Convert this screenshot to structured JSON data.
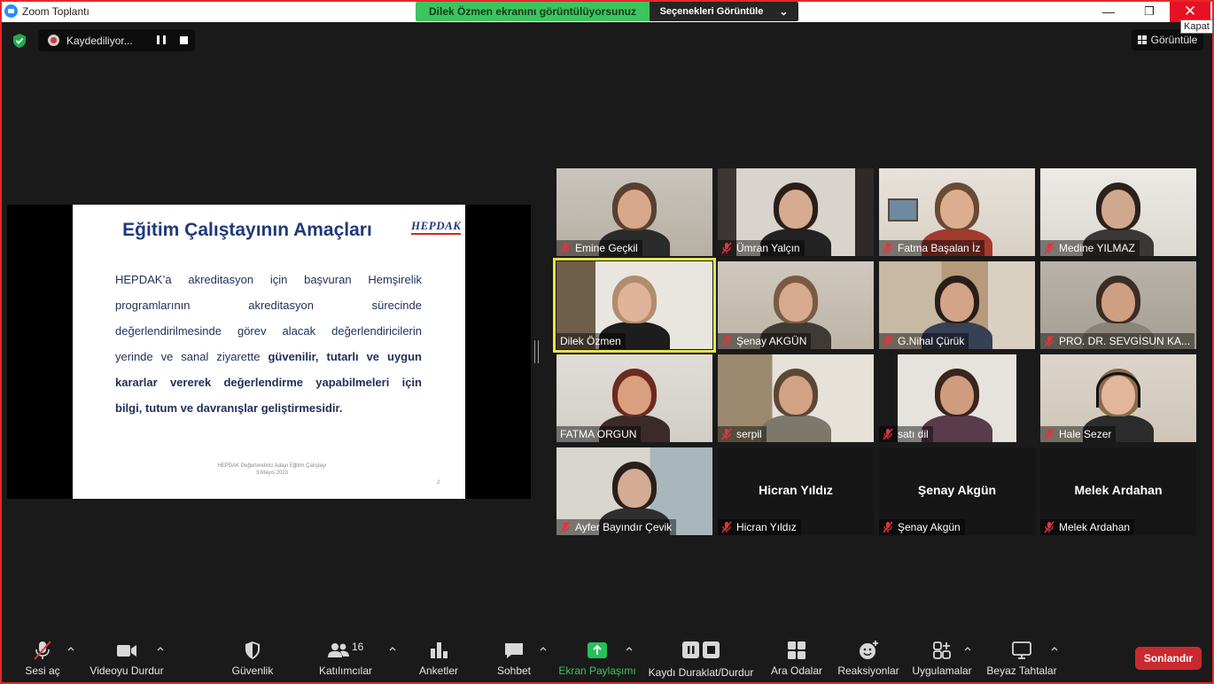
{
  "window": {
    "title": "Zoom Toplantı",
    "close_tooltip": "Kapat",
    "minimize_glyph": "—",
    "maximize_glyph": "❐",
    "close_glyph": "✕"
  },
  "share_banner": {
    "text": "Dilek Özmen ekranını görüntülüyorsunuz",
    "options_label": "Seçenekleri Görüntüle",
    "options_glyph": "⌄"
  },
  "recording": {
    "label": "Kaydediliyor..."
  },
  "view_button": {
    "label": "Görüntüle"
  },
  "slide": {
    "title": "Eğitim Çalıştayının Amaçları",
    "logo": "HEPDAK",
    "lines": [
      "HEPDAK’a  akreditasyon için başvuran Hemşirelik",
      "programlarının akreditasyon sürecinde",
      "değerlendirilmesinde görev alacak değerlendiricilerin"
    ],
    "line4_normal": "yerinde ve sanal ziyarette ",
    "line4_bold": "güvenilir, tutarlı ve uygun",
    "bold_lines": [
      "kararlar vererek değerlendirme yapabilmeleri için",
      "bilgi, tutum ve davranışlar geliştirmesidir."
    ],
    "footer_line1": "HEPDAK Değerlendirici Adayı Eğitim Çalıştayı",
    "footer_line2": "3 Mayıs 2023",
    "page": "2"
  },
  "participants": [
    {
      "name": "Emine Geçkil",
      "muted": true
    },
    {
      "name": "Ümran Yalçın",
      "muted": true
    },
    {
      "name": "Fatma Başalan İz",
      "muted": true
    },
    {
      "name": "Medine YILMAZ",
      "muted": true
    },
    {
      "name": "Dilek Özmen",
      "muted": false,
      "active_speaker": true
    },
    {
      "name": "Şenay AKGÜN",
      "muted": true
    },
    {
      "name": "G.Nihal Çürük",
      "muted": true
    },
    {
      "name": "PRO. DR. SEVGİSUN KA...",
      "muted": true
    },
    {
      "name": "FATMA ORGUN",
      "muted": false
    },
    {
      "name": "serpil",
      "muted": true
    },
    {
      "name": "satı dil",
      "muted": true
    },
    {
      "name": "Hale Sezer",
      "muted": true
    },
    {
      "name": "Ayfer Bayındır Çevik",
      "muted": true
    },
    {
      "name": "Hicran Yıldız",
      "muted": true,
      "video_off": true,
      "display_name": "Hicran Yıldız"
    },
    {
      "name": "Şenay Akgün",
      "muted": true,
      "video_off": true,
      "display_name": "Şenay Akgün"
    },
    {
      "name": "Melek Ardahan",
      "muted": true,
      "video_off": true,
      "display_name": "Melek Ardahan"
    }
  ],
  "toolbar": {
    "unmute": "Sesi aç",
    "stop_video": "Videoyu Durdur",
    "security": "Güvenlik",
    "participants": "Katılımcılar",
    "participants_count": "16",
    "polls": "Anketler",
    "chat": "Sohbet",
    "share_screen": "Ekran Paylaşımı",
    "pause_stop_recording": "Kaydı Duraklat/Durdur",
    "breakout_rooms": "Ara Odalar",
    "reactions": "Reaksiyonlar",
    "apps": "Uygulamalar",
    "whiteboard": "Beyaz Tahtalar",
    "end": "Sonlandır"
  },
  "colors": {
    "accent_green": "#3ec45e",
    "end_red": "#c9292f",
    "frame_red": "#e8262b",
    "active_speaker": "#e5e34c",
    "mute_red": "#e0353d"
  }
}
